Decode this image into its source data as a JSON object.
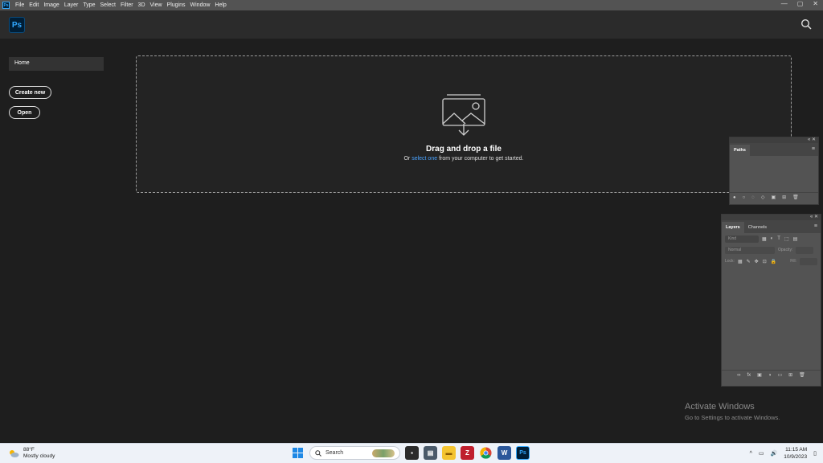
{
  "menubar": {
    "app_abbrev": "Ps",
    "items": [
      "File",
      "Edit",
      "Image",
      "Layer",
      "Type",
      "Select",
      "Filter",
      "3D",
      "View",
      "Plugins",
      "Window",
      "Help"
    ],
    "window_controls": [
      "—",
      "▢",
      "✕"
    ]
  },
  "header": {
    "logo": "Ps",
    "search_icon": "search-icon"
  },
  "nav": {
    "home": "Home",
    "create_new": "Create new",
    "open": "Open"
  },
  "dropzone": {
    "title": "Drag and drop a file",
    "sub_prefix": "Or ",
    "sub_link": "select one",
    "sub_suffix": " from your computer to get started."
  },
  "paths_panel": {
    "tab": "Paths",
    "controls": "« ✕"
  },
  "layers_panel": {
    "tabs": [
      "Layers",
      "Channels"
    ],
    "kind_placeholder": "Kind",
    "blend_mode": "Normal",
    "opacity_label": "Opacity:",
    "lock_label": "Lock:",
    "fill_label": "Fill:",
    "controls": "« ✕"
  },
  "watermark": {
    "line1": "Activate Windows",
    "line2": "Go to Settings to activate Windows."
  },
  "taskbar": {
    "weather_temp": "88°F",
    "weather_desc": "Mostly cloudy",
    "search_placeholder": "Search",
    "time": "11:15 AM",
    "date": "10/9/2023"
  },
  "colors": {
    "accent": "#31a8ff",
    "link": "#4aa3ff",
    "bg": "#1e1e1e",
    "panel": "#535353"
  }
}
